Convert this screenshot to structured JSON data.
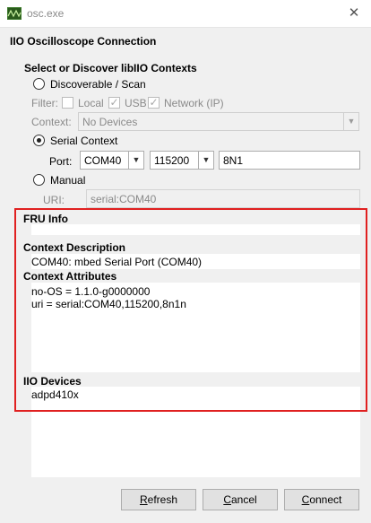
{
  "window": {
    "title": "osc.exe",
    "close_glyph": "✕"
  },
  "heading": "IIO Oscilloscope Connection",
  "select_section": {
    "title": "Select or Discover libIIO Contexts",
    "discoverable_label": "Discoverable / Scan",
    "filter_label": "Filter:",
    "filters": [
      {
        "label": "Local",
        "checked": false
      },
      {
        "label": "USB",
        "checked": true
      },
      {
        "label": "Network (IP)",
        "checked": true
      }
    ],
    "context_label": "Context:",
    "context_value": "No Devices",
    "serial_label": "Serial Context",
    "port_label": "Port:",
    "port_value": "COM40",
    "baud_value": "115200",
    "config_value": "8N1",
    "manual_label": "Manual",
    "uri_label": "URI:",
    "uri_value": "serial:COM40",
    "selected_mode": "Serial Context"
  },
  "info": {
    "fru_title": "FRU Info",
    "context_desc_title": "Context Description",
    "context_desc_value": "COM40: mbed Serial Port (COM40)",
    "context_attr_title": "Context Attributes",
    "context_attrs": [
      "no-OS = 1.1.0-g0000000",
      "uri = serial:COM40,115200,8n1n"
    ],
    "iio_devices_title": "IIO Devices",
    "iio_devices": [
      "adpd410x"
    ]
  },
  "buttons": {
    "refresh": {
      "first": "R",
      "rest": "efresh"
    },
    "cancel": {
      "first": "C",
      "rest": "ancel"
    },
    "connect": {
      "first": "C",
      "rest": "onnect"
    }
  },
  "colors": {
    "highlight_frame": "#e02020",
    "window_bg": "#f0f0f0"
  }
}
